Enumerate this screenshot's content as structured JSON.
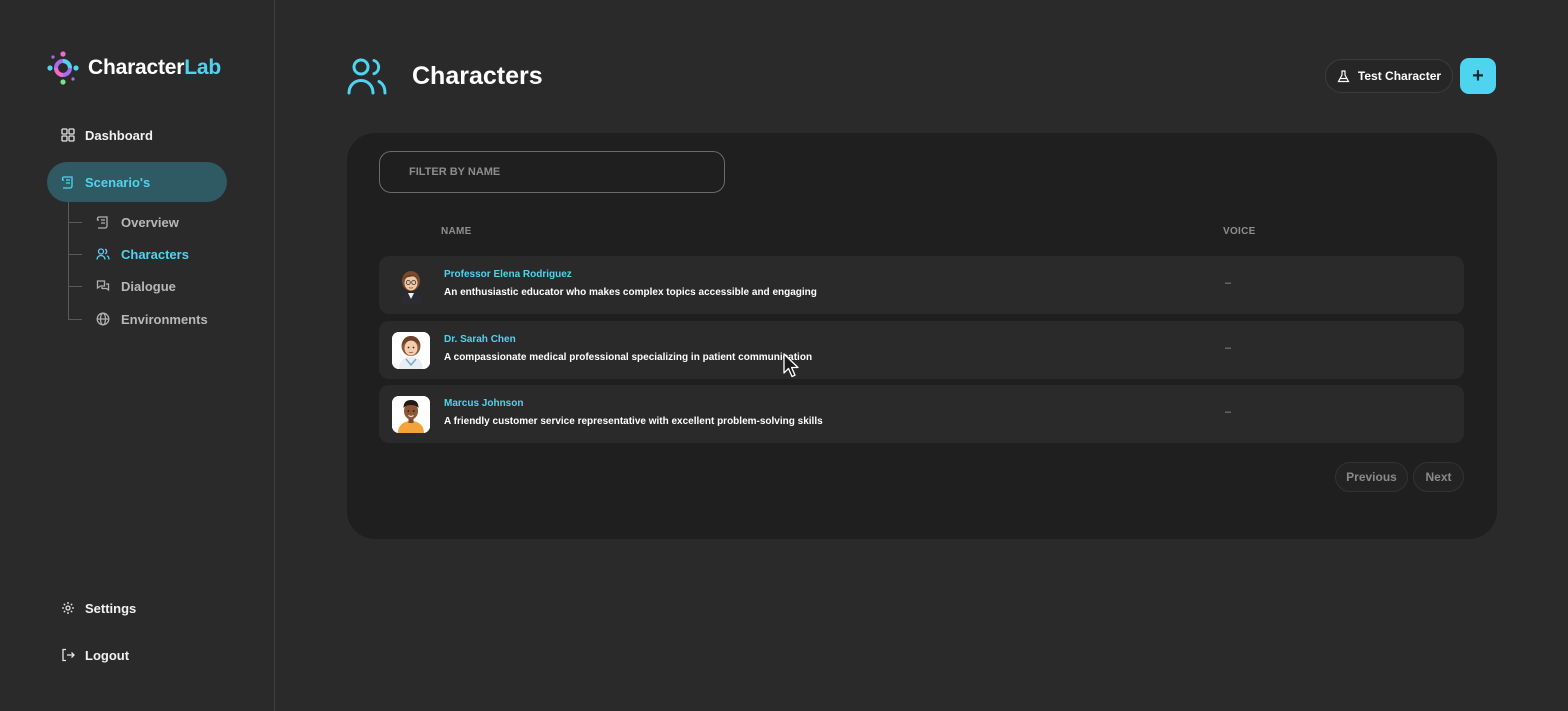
{
  "app": {
    "logo_first": "Character",
    "logo_second": "Lab",
    "accent_color": "#4fd4f0"
  },
  "sidebar": {
    "items": [
      {
        "label": "Dashboard",
        "icon": "dashboard-grid-icon"
      },
      {
        "label": "Scenario's",
        "icon": "scroll-icon",
        "active": true
      }
    ],
    "sub_items": [
      {
        "label": "Overview",
        "icon": "scroll-icon"
      },
      {
        "label": "Characters",
        "icon": "users-icon",
        "active": true
      },
      {
        "label": "Dialogue",
        "icon": "chat-bubbles-icon"
      },
      {
        "label": "Environments",
        "icon": "globe-icon"
      }
    ],
    "bottom": [
      {
        "label": "Settings",
        "icon": "gear-icon"
      },
      {
        "label": "Logout",
        "icon": "logout-arrow-icon"
      }
    ]
  },
  "header": {
    "title": "Characters",
    "icon": "users-icon",
    "test_button_label": "Test Character",
    "test_button_icon": "flask-icon",
    "add_button_label": "+"
  },
  "filter": {
    "placeholder": "FILTER BY NAME",
    "value": ""
  },
  "table": {
    "columns": [
      "NAME",
      "VOICE"
    ],
    "rows": [
      {
        "name": "Professor Elena Rodriguez",
        "description": "An enthusiastic educator who makes complex topics accessible and engaging",
        "voice": "–",
        "avatar": "professor-avatar"
      },
      {
        "name": "Dr. Sarah Chen",
        "description": "A compassionate medical professional specializing in patient communication",
        "voice": "–",
        "avatar": "doctor-avatar"
      },
      {
        "name": "Marcus Johnson",
        "description": "A friendly customer service representative with excellent problem-solving skills",
        "voice": "–",
        "avatar": "customer-service-avatar"
      }
    ]
  },
  "pagination": {
    "previous_label": "Previous",
    "next_label": "Next"
  }
}
